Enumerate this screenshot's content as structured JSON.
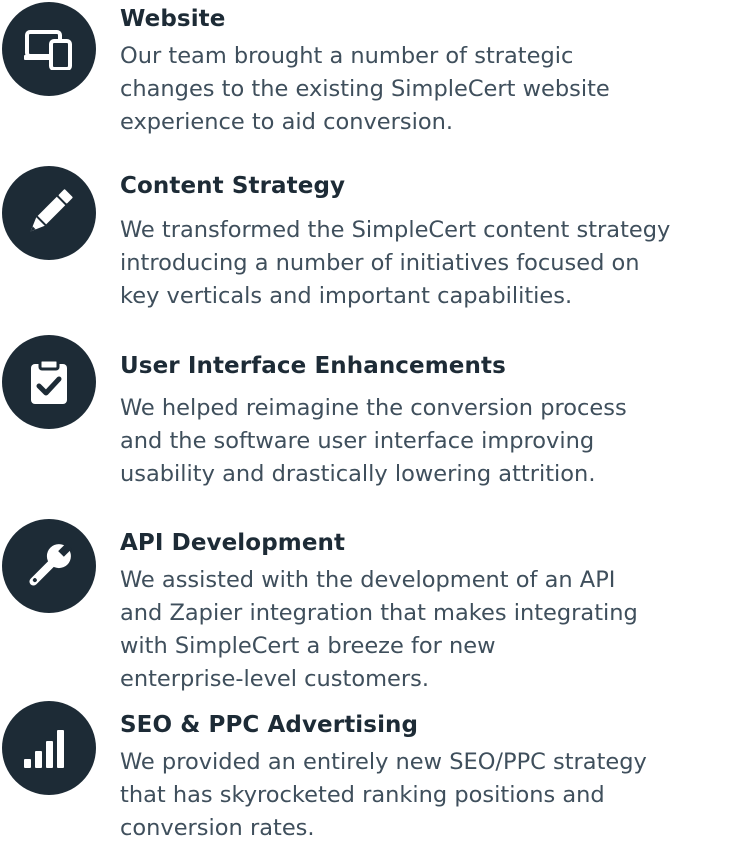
{
  "colors": {
    "icon_bg": "#1d2b36",
    "title": "#1d2b36",
    "text": "#3f4f5c"
  },
  "items": [
    {
      "icon": "devices-icon",
      "title": "Website",
      "lines": [
        "Our team brought a number of strategic",
        "changes to the existing SimpleCert website",
        "experience to aid conversion."
      ]
    },
    {
      "icon": "pencil-icon",
      "title": "Content Strategy",
      "lines": [
        "We transformed the SimpleCert content strategy",
        "introducing a number of initiatives focused on",
        "key verticals and important capabilities."
      ]
    },
    {
      "icon": "clipboard-check-icon",
      "title": "User Interface Enhancements",
      "lines": [
        "We helped reimagine the conversion process",
        "and the software user interface improving",
        "usability and drastically lowering attrition."
      ]
    },
    {
      "icon": "wrench-icon",
      "title": "API Development",
      "lines": [
        "We assisted with the development of an API",
        "and Zapier integration that makes integrating",
        "with SimpleCert a breeze for new",
        "enterprise-level customers."
      ]
    },
    {
      "icon": "signal-bars-icon",
      "title": "SEO & PPC Advertising",
      "lines": [
        "We provided an entirely new SEO/PPC strategy",
        "that has skyrocketed ranking positions and",
        "conversion rates."
      ]
    }
  ]
}
